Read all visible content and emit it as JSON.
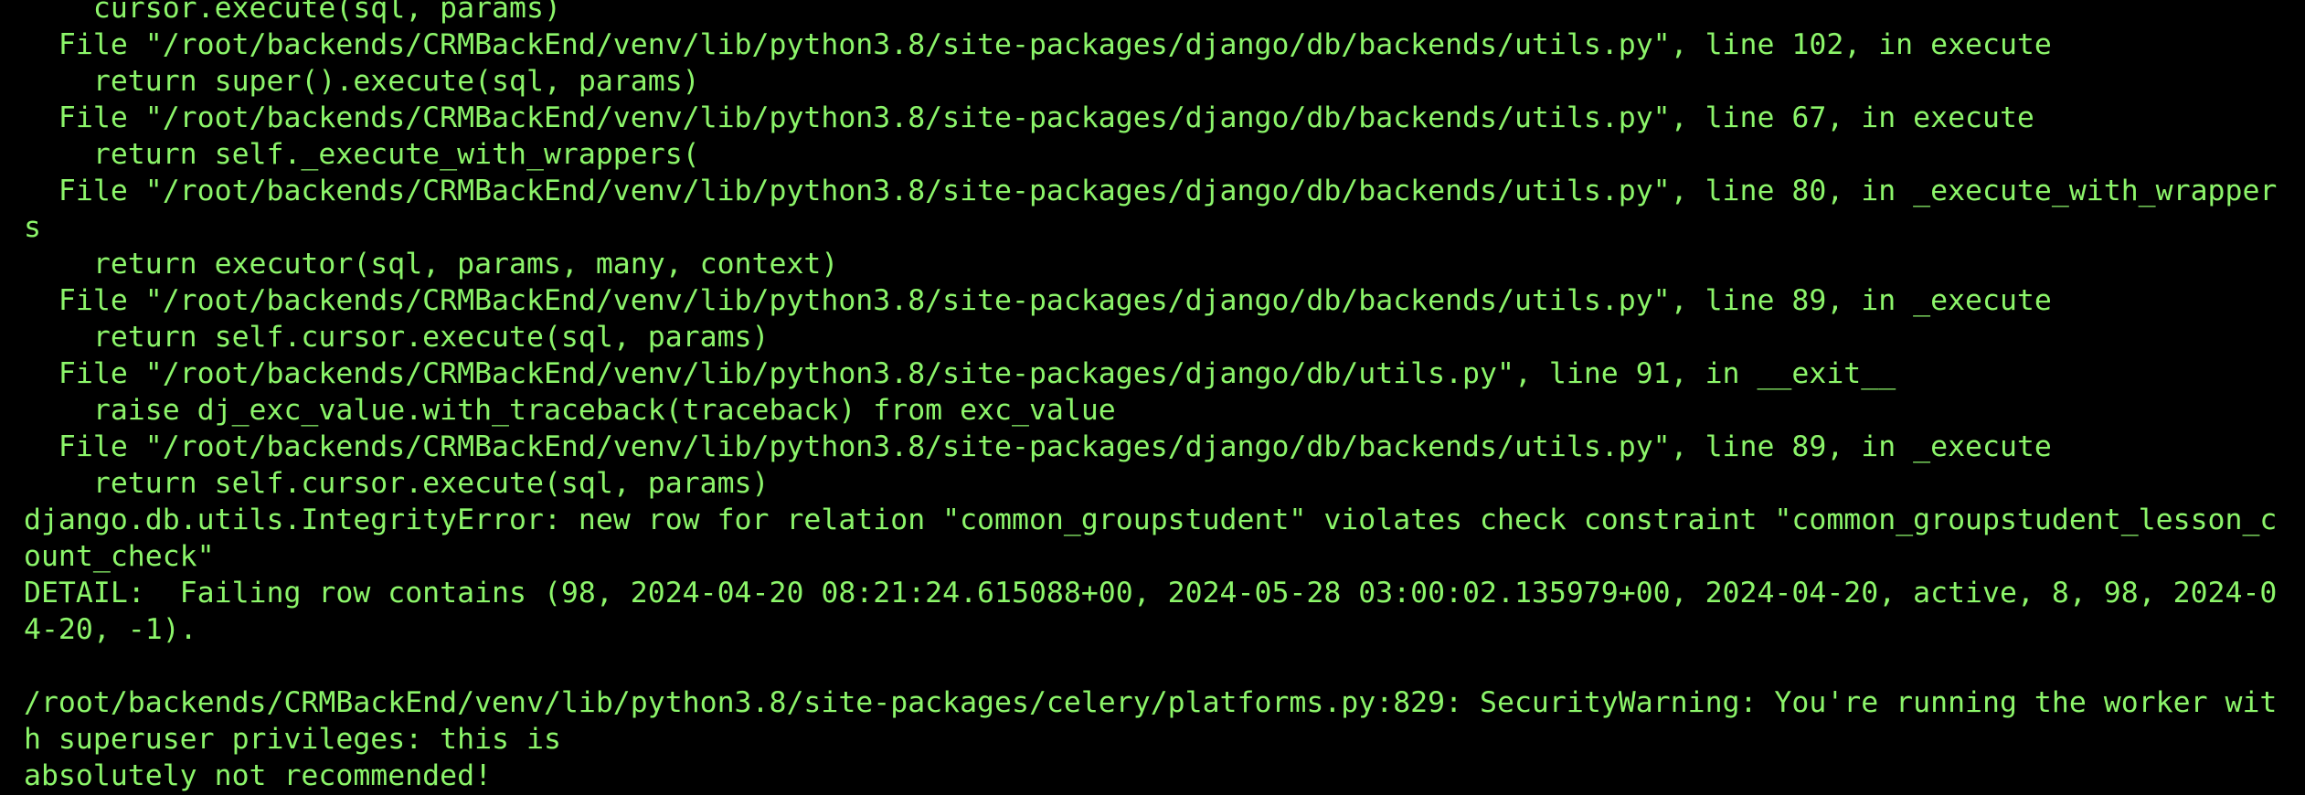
{
  "terminal": {
    "text_color": "#8cf56a",
    "background_color": "#000000",
    "lines": [
      "    cursor.execute(sql, params)",
      "  File \"/root/backends/CRMBackEnd/venv/lib/python3.8/site-packages/django/db/backends/utils.py\", line 102, in execute",
      "    return super().execute(sql, params)",
      "  File \"/root/backends/CRMBackEnd/venv/lib/python3.8/site-packages/django/db/backends/utils.py\", line 67, in execute",
      "    return self._execute_with_wrappers(",
      "  File \"/root/backends/CRMBackEnd/venv/lib/python3.8/site-packages/django/db/backends/utils.py\", line 80, in _execute_with_wrapper",
      "s",
      "    return executor(sql, params, many, context)",
      "  File \"/root/backends/CRMBackEnd/venv/lib/python3.8/site-packages/django/db/backends/utils.py\", line 89, in _execute",
      "    return self.cursor.execute(sql, params)",
      "  File \"/root/backends/CRMBackEnd/venv/lib/python3.8/site-packages/django/db/utils.py\", line 91, in __exit__",
      "    raise dj_exc_value.with_traceback(traceback) from exc_value",
      "  File \"/root/backends/CRMBackEnd/venv/lib/python3.8/site-packages/django/db/backends/utils.py\", line 89, in _execute",
      "    return self.cursor.execute(sql, params)",
      "django.db.utils.IntegrityError: new row for relation \"common_groupstudent\" violates check constraint \"common_groupstudent_lesson_c",
      "ount_check\"",
      "DETAIL:  Failing row contains (98, 2024-04-20 08:21:24.615088+00, 2024-05-28 03:00:02.135979+00, 2024-04-20, active, 8, 98, 2024-0",
      "4-20, -1).",
      "",
      "/root/backends/CRMBackEnd/venv/lib/python3.8/site-packages/celery/platforms.py:829: SecurityWarning: You're running the worker wit",
      "h superuser privileges: this is",
      "absolutely not recommended!"
    ]
  }
}
